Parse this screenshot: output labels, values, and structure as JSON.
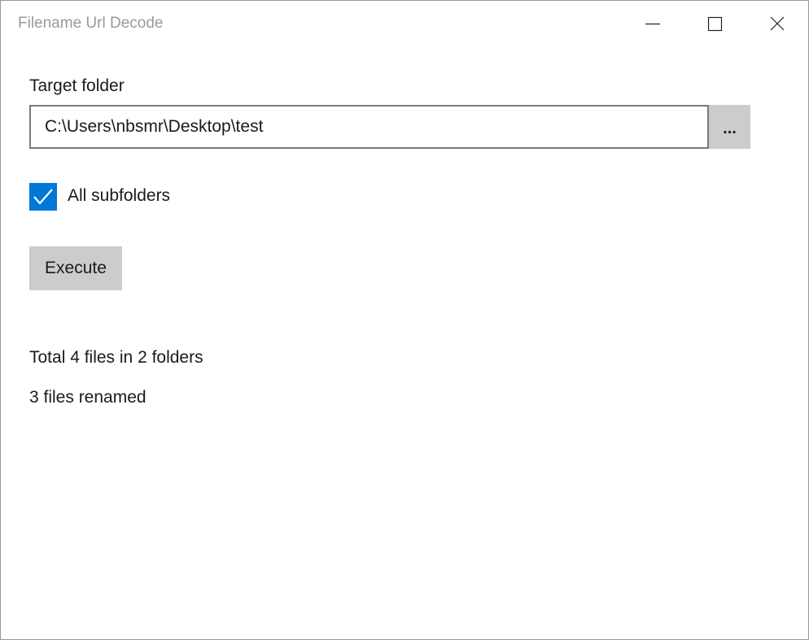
{
  "window": {
    "title": "Filename Url Decode",
    "controls": {
      "minimize_icon": "minimize-icon",
      "maximize_icon": "maximize-icon",
      "close_icon": "close-icon"
    }
  },
  "form": {
    "target_label": "Target folder",
    "target_value": "C:\\Users\\nbsmr\\Desktop\\test",
    "browse_label": "...",
    "subfolders_label": "All subfolders",
    "subfolders_checked": true,
    "execute_label": "Execute"
  },
  "status": {
    "summary": "Total 4 files in 2 folders",
    "result": "3 files renamed"
  },
  "colors": {
    "accent": "#0078d7",
    "button_bg": "#cccccc",
    "title_text": "#9a9a9a"
  }
}
